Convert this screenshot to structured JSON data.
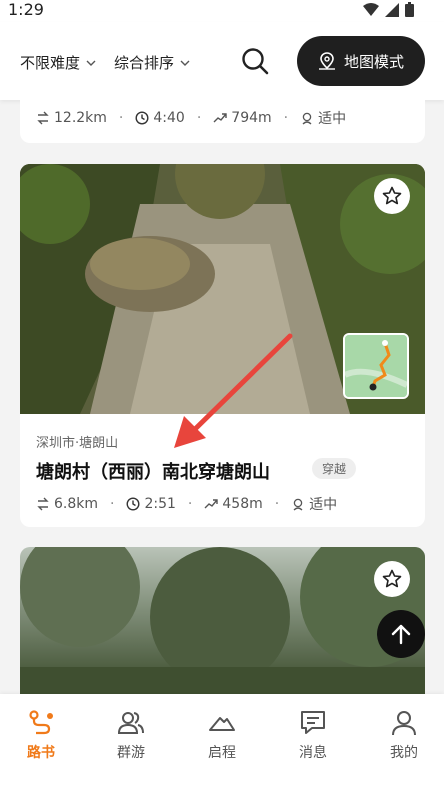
{
  "status": {
    "time": "1:29"
  },
  "toolbar": {
    "filter_difficulty": "不限难度",
    "filter_sort": "综合排序",
    "map_mode": "地图模式"
  },
  "previous_card": {
    "distance": "12.2km",
    "duration": "4:40",
    "elevation": "794m",
    "level": "适中"
  },
  "card": {
    "location": "深圳市·塘朗山",
    "title": "塘朗村（西丽）南北穿塘朗山",
    "tag": "穿越",
    "distance": "6.8km",
    "duration": "2:51",
    "elevation": "458m",
    "level": "适中"
  },
  "tabs": [
    {
      "label": "路书",
      "icon": "route-icon",
      "active": true
    },
    {
      "label": "群游",
      "icon": "group-icon",
      "active": false
    },
    {
      "label": "启程",
      "icon": "start-icon",
      "active": false
    },
    {
      "label": "消息",
      "icon": "message-icon",
      "active": false
    },
    {
      "label": "我的",
      "icon": "profile-icon",
      "active": false
    }
  ],
  "colors": {
    "accent": "#f07a1a",
    "dark": "#1f1f1f",
    "annotation": "#e8453c"
  }
}
